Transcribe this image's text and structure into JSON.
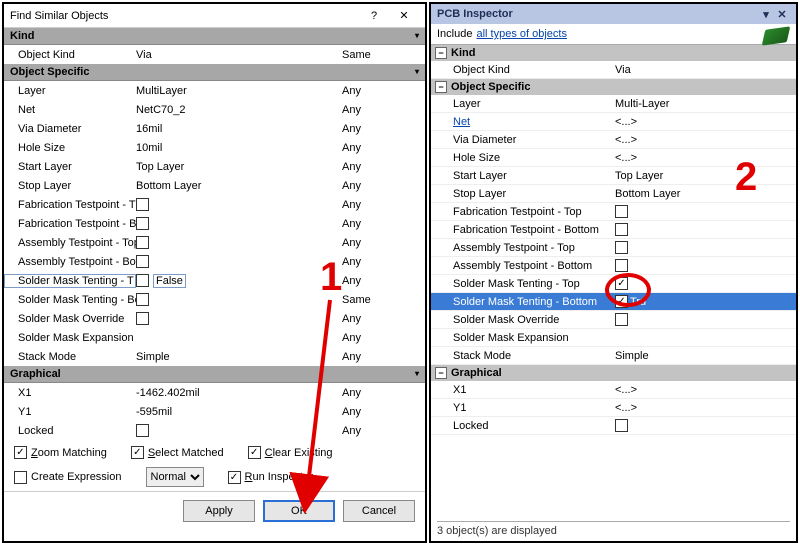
{
  "dialog": {
    "title": "Find Similar Objects",
    "sections": {
      "kind": {
        "label": "Kind",
        "rows": [
          {
            "name": "Object Kind",
            "value": "Via",
            "match": "Same"
          }
        ]
      },
      "objspec": {
        "label": "Object Specific",
        "rows": [
          {
            "name": "Layer",
            "value": "MultiLayer",
            "match": "Any"
          },
          {
            "name": "Net",
            "value": "NetC70_2",
            "match": "Any"
          },
          {
            "name": "Via Diameter",
            "value": "16mil",
            "match": "Any"
          },
          {
            "name": "Hole Size",
            "value": "10mil",
            "match": "Any"
          },
          {
            "name": "Start Layer",
            "value": "Top Layer",
            "match": "Any"
          },
          {
            "name": "Stop Layer",
            "value": "Bottom Layer",
            "match": "Any"
          },
          {
            "name": "Fabrication Testpoint - T",
            "checkbox": true,
            "checked": false,
            "match": "Any"
          },
          {
            "name": "Fabrication Testpoint - B",
            "checkbox": true,
            "checked": false,
            "match": "Any"
          },
          {
            "name": "Assembly Testpoint - Top",
            "checkbox": true,
            "checked": false,
            "match": "Any"
          },
          {
            "name": "Assembly Testpoint - Bot",
            "checkbox": true,
            "checked": false,
            "match": "Any"
          },
          {
            "name": "Solder Mask Tenting - T",
            "checkbox": true,
            "checked": false,
            "text": "False",
            "match": "Any",
            "selected": true
          },
          {
            "name": "Solder Mask Tenting - Bo",
            "checkbox": true,
            "checked": false,
            "match": "Same"
          },
          {
            "name": "Solder Mask Override",
            "checkbox": true,
            "checked": false,
            "match": "Any"
          },
          {
            "name": "Solder Mask Expansion",
            "value": "",
            "match": "Any"
          },
          {
            "name": "Stack Mode",
            "value": "Simple",
            "match": "Any"
          }
        ]
      },
      "graphical": {
        "label": "Graphical",
        "rows": [
          {
            "name": "X1",
            "value": "-1462.402mil",
            "match": "Any"
          },
          {
            "name": "Y1",
            "value": "-595mil",
            "match": "Any"
          },
          {
            "name": "Locked",
            "checkbox": true,
            "checked": false,
            "match": "Any"
          }
        ]
      }
    },
    "opts": {
      "zoom": {
        "label_pre": "Z",
        "label_rest": "oom Matching",
        "checked": true
      },
      "select": {
        "label_pre": "S",
        "label_rest": "elect Matched",
        "checked": true
      },
      "clear": {
        "label_pre": "C",
        "label_rest": "lear Existing",
        "checked": true
      },
      "create": {
        "label": "Create Expression",
        "checked": false
      },
      "mask": {
        "value": "Normal"
      },
      "run": {
        "label_pre": "R",
        "label_rest": "un Inspector",
        "checked": true
      }
    },
    "buttons": {
      "apply": "Apply",
      "ok": "OK",
      "cancel": "Cancel"
    }
  },
  "inspector": {
    "title": "PCB Inspector",
    "include_pre": "Include",
    "include_link": "all types of objects",
    "sections": {
      "kind": {
        "label": "Kind",
        "rows": [
          {
            "name": "Object Kind",
            "value": "Via"
          }
        ]
      },
      "objspec": {
        "label": "Object Specific",
        "rows": [
          {
            "name": "Layer",
            "value": "Multi-Layer"
          },
          {
            "name": "Net",
            "value": "<...>",
            "link": true
          },
          {
            "name": "Via Diameter",
            "value": "<...>"
          },
          {
            "name": "Hole Size",
            "value": "<...>"
          },
          {
            "name": "Start Layer",
            "value": "Top Layer"
          },
          {
            "name": "Stop Layer",
            "value": "Bottom Layer"
          },
          {
            "name": "Fabrication Testpoint - Top",
            "checkbox": true,
            "checked": false
          },
          {
            "name": "Fabrication Testpoint - Bottom",
            "checkbox": true,
            "checked": false
          },
          {
            "name": "Assembly Testpoint - Top",
            "checkbox": true,
            "checked": false
          },
          {
            "name": "Assembly Testpoint - Bottom",
            "checkbox": true,
            "checked": false
          },
          {
            "name": "Solder Mask Tenting - Top",
            "checkbox": true,
            "checked": true
          },
          {
            "name": "Solder Mask Tenting - Bottom",
            "checkbox": true,
            "checked": true,
            "text": "Tru",
            "highlight": true
          },
          {
            "name": "Solder Mask Override",
            "checkbox": true,
            "checked": false
          },
          {
            "name": "Solder Mask Expansion",
            "value": ""
          },
          {
            "name": "Stack Mode",
            "value": "Simple"
          }
        ]
      },
      "graphical": {
        "label": "Graphical",
        "rows": [
          {
            "name": "X1",
            "value": "<...>"
          },
          {
            "name": "Y1",
            "value": "<...>"
          },
          {
            "name": "Locked",
            "checkbox": true,
            "checked": false
          }
        ]
      }
    },
    "status": "3 object(s) are displayed"
  },
  "anno": {
    "one": "1",
    "two": "2"
  }
}
